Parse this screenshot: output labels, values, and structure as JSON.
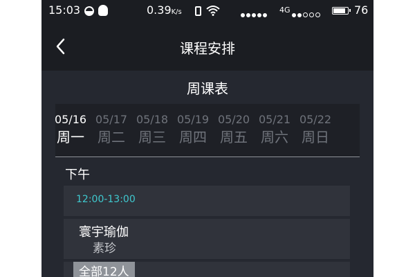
{
  "status_bar": {
    "time": "15:03",
    "speed": "0.39",
    "speed_unit": "K/s",
    "network": "4G",
    "battery": "76"
  },
  "nav": {
    "title": "课程安排"
  },
  "schedule": {
    "section_title": "周课表",
    "days": [
      {
        "date": "05/16",
        "weekday": "周一",
        "selected": true
      },
      {
        "date": "05/17",
        "weekday": "周二",
        "selected": false
      },
      {
        "date": "05/18",
        "weekday": "周三",
        "selected": false
      },
      {
        "date": "05/19",
        "weekday": "周四",
        "selected": false
      },
      {
        "date": "05/20",
        "weekday": "周五",
        "selected": false
      },
      {
        "date": "05/21",
        "weekday": "周六",
        "selected": false
      },
      {
        "date": "05/22",
        "weekday": "周日",
        "selected": false
      }
    ],
    "period": "下午",
    "time_slot": "12:00-13:00",
    "course": {
      "name": "寰宇瑜伽",
      "teacher": "素珍"
    },
    "count_label": "全部12人"
  },
  "colors": {
    "background": "#252830",
    "header": "#1b1d22",
    "accent": "#3fc9cf",
    "inactive": "#6f737b"
  }
}
